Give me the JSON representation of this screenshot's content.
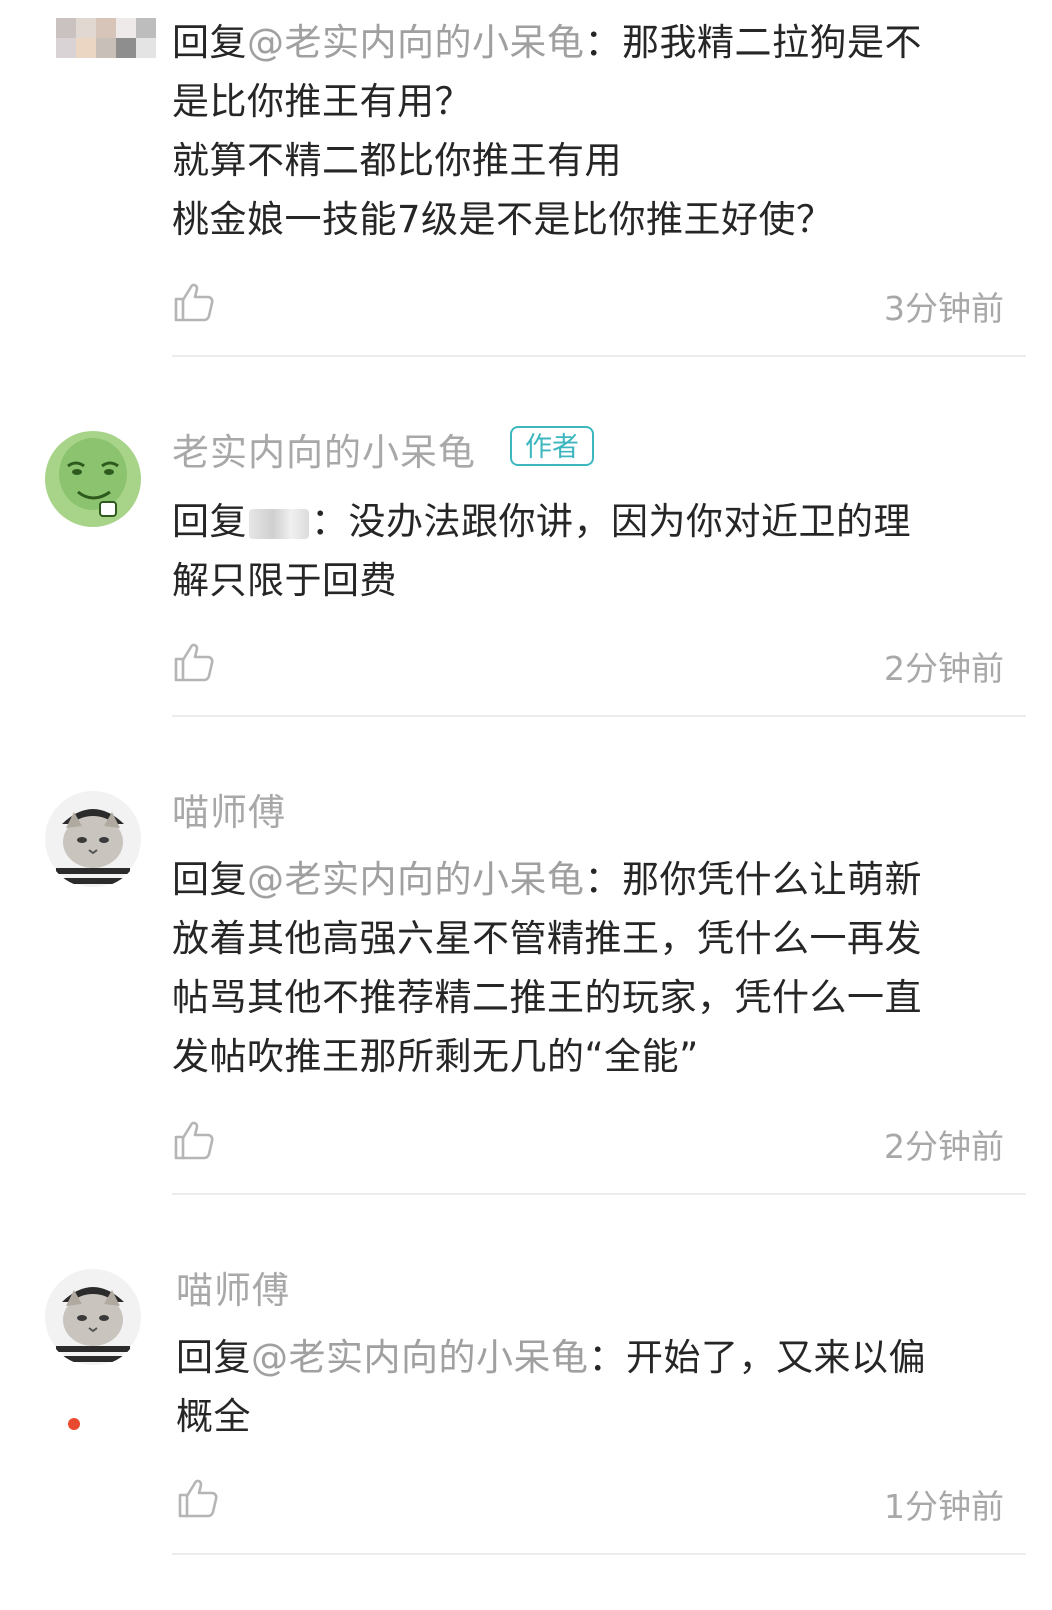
{
  "comments": [
    {
      "username": "",
      "reply_prefix": "回复",
      "mention": "@老实内向的小呆龟",
      "colon": "：",
      "lines": [
        "那我精二拉狗是不",
        "是比你推王有用？",
        "就算不精二都比你推王有用",
        "桃金娘一技能7级是不是比你推王好使？"
      ],
      "time": "3分钟前"
    },
    {
      "username": "老实内向的小呆龟",
      "badge": "作者",
      "reply_prefix": "回复",
      "colon": "：",
      "lines": [
        "没办法跟你讲，因为你对近卫的理",
        "解只限于回费"
      ],
      "time": "2分钟前"
    },
    {
      "username": "喵师傅",
      "reply_prefix": "回复",
      "mention": "@老实内向的小呆龟",
      "colon": "：",
      "lines": [
        "那你凭什么让萌新",
        "放着其他高强六星不管精推王，凭什么一再发",
        "帖骂其他不推荐精二推王的玩家，凭什么一直",
        "发帖吹推王那所剩无几的“全能”"
      ],
      "time": "2分钟前"
    },
    {
      "username": "喵师傅",
      "reply_prefix": "回复",
      "mention": "@老实内向的小呆龟",
      "colon": "：",
      "lines": [
        "开始了，又来以偏",
        "概全"
      ],
      "time": "1分钟前"
    }
  ],
  "icons": {
    "like": "thumbs-up-icon"
  },
  "colors": {
    "badge": "#3db6bf",
    "muted": "#a8a8a8",
    "text": "#262626",
    "notification_dot": "#e8492f"
  }
}
